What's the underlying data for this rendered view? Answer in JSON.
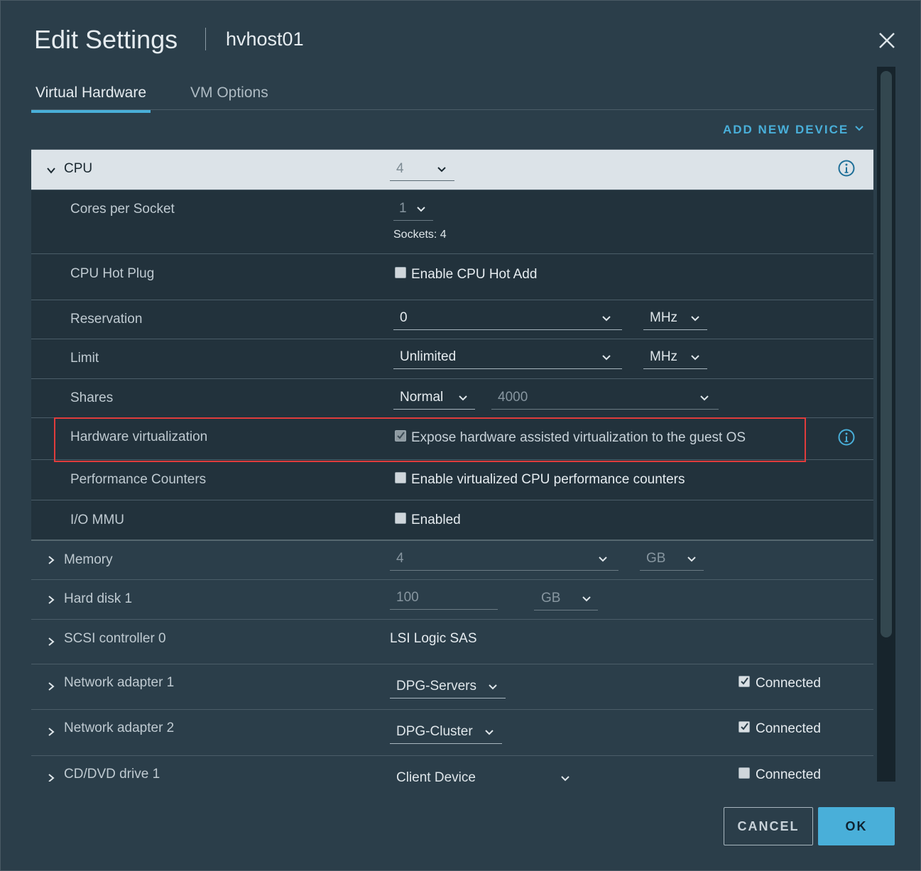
{
  "dialog": {
    "title": "Edit Settings",
    "subtitle": "hvhost01"
  },
  "tabs": [
    {
      "label": "Virtual Hardware",
      "active": true
    },
    {
      "label": "VM Options",
      "active": false
    }
  ],
  "add_new_device": "ADD NEW DEVICE",
  "cpu": {
    "label": "CPU",
    "value": "4",
    "cores_per_socket": {
      "label": "Cores per Socket",
      "value": "1",
      "sockets": "Sockets: 4"
    },
    "hot_plug": {
      "label": "CPU Hot Plug",
      "option": "Enable CPU Hot Add",
      "checked": false
    },
    "reservation": {
      "label": "Reservation",
      "value": "0",
      "unit": "MHz"
    },
    "limit": {
      "label": "Limit",
      "value": "Unlimited",
      "unit": "MHz"
    },
    "shares": {
      "label": "Shares",
      "level": "Normal",
      "value": "4000"
    },
    "hw_virtualization": {
      "label": "Hardware virtualization",
      "option": "Expose hardware assisted virtualization to the guest OS",
      "checked": true
    },
    "perf_counters": {
      "label": "Performance Counters",
      "option": "Enable virtualized CPU performance counters",
      "checked": false
    },
    "iommu": {
      "label": "I/O MMU",
      "option": "Enabled",
      "checked": false
    }
  },
  "devices": {
    "memory": {
      "label": "Memory",
      "value": "4",
      "unit": "GB"
    },
    "hard_disk": {
      "label": "Hard disk 1",
      "value": "100",
      "unit": "GB"
    },
    "scsi": {
      "label": "SCSI controller 0",
      "value": "LSI Logic SAS"
    },
    "net1": {
      "label": "Network adapter 1",
      "value": "DPG-Servers",
      "connected_label": "Connected",
      "connected": true
    },
    "net2": {
      "label": "Network adapter 2",
      "value": "DPG-Cluster",
      "connected_label": "Connected",
      "connected": true
    },
    "cdrom": {
      "label": "CD/DVD drive 1",
      "value": "Client Device",
      "connected_label": "Connected",
      "connected": false
    }
  },
  "buttons": {
    "cancel": "CANCEL",
    "ok": "OK"
  },
  "colors": {
    "accent": "#49afd9",
    "highlight_box": "#e03c3c",
    "background": "#2b3e4a"
  }
}
